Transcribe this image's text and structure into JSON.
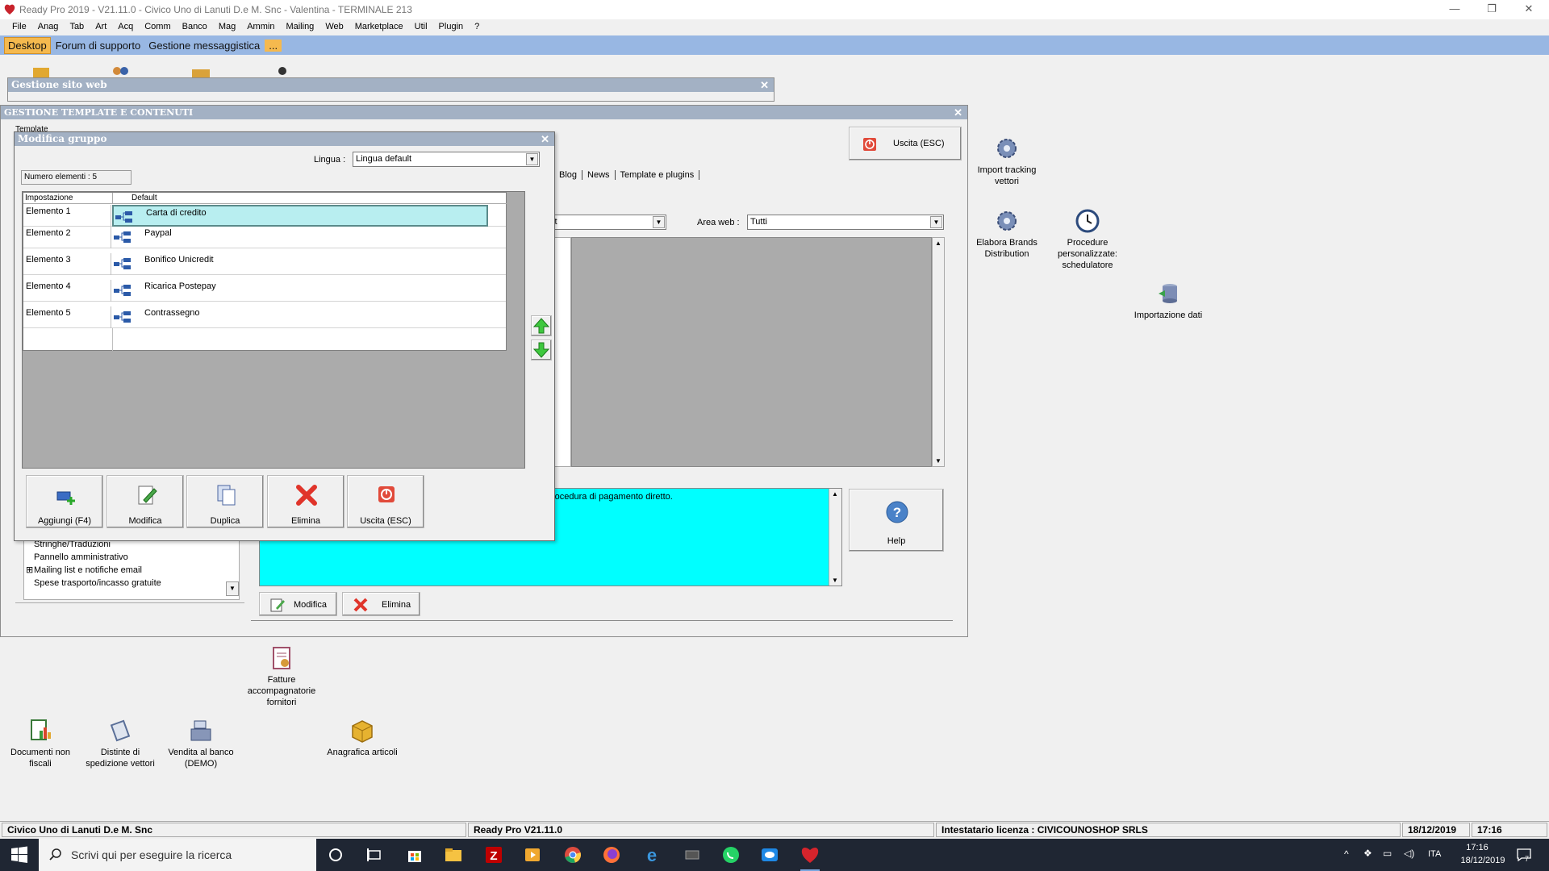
{
  "app_title": "Ready Pro 2019 - V21.11.0 - Civico Uno di Lanuti D.e M. Snc - Valentina - TERMINALE 213",
  "window_controls": {
    "minimize": "—",
    "restore": "❐",
    "close": "✕"
  },
  "menu": [
    "File",
    "Anag",
    "Tab",
    "Art",
    "Acq",
    "Comm",
    "Banco",
    "Mag",
    "Ammin",
    "Mailing",
    "Web",
    "Marketplace",
    "Util",
    "Plugin",
    "?"
  ],
  "tabs": [
    {
      "label": "Desktop",
      "active": true
    },
    {
      "label": "Forum di supporto",
      "active": false
    },
    {
      "label": "Gestione messaggistica",
      "active": false
    },
    {
      "label": "...",
      "active": false
    }
  ],
  "desktop_right_icons": [
    {
      "label": "Import tracking vettori",
      "icon": "gear-icon"
    },
    {
      "label": "Elabora Brands Distribution",
      "icon": "gear-icon"
    },
    {
      "label": "Procedure personalizzate: schedulatore",
      "icon": "clock-icon"
    },
    {
      "label": "Importazione dati",
      "icon": "database-icon"
    }
  ],
  "desktop_bottom_icons": [
    {
      "label": "Fatture accompagnatorie fornitori",
      "icon": "invoice-icon"
    },
    {
      "label": "Documenti non fiscali",
      "icon": "document-chart-icon"
    },
    {
      "label": "Distinte di spedizione vettori",
      "icon": "scroll-icon"
    },
    {
      "label": "Vendita al banco (DEMO)",
      "icon": "cash-register-icon"
    },
    {
      "label": "Anagrafica articoli",
      "icon": "box-icon"
    }
  ],
  "gestione_sito": {
    "title": "Gestione sito web"
  },
  "gestione_template": {
    "title": "GESTIONE TEMPLATE E CONTENUTI",
    "template_label": "Template",
    "exit_button": "Uscita (ESC)",
    "tabs": [
      "Blog",
      "News",
      "Template e plugins"
    ],
    "combo_partial": "lt",
    "area_web_label": "Area web :",
    "area_web_value": "Tutti",
    "description": "rocedura di pagamento diretto.",
    "help_button": "Help",
    "modifica_button": "Modifica",
    "elimina_button": "Elimina",
    "tree_items": [
      {
        "label": "Stringhe/Traduzioni",
        "expand": ""
      },
      {
        "label": "Pannello amministrativo",
        "expand": ""
      },
      {
        "label": "Mailing list e notifiche email",
        "expand": "⊞"
      },
      {
        "label": "Spese trasporto/incasso gratuite",
        "expand": ""
      }
    ]
  },
  "modifica_gruppo": {
    "title": "Modifica gruppo",
    "lingua_label": "Lingua :",
    "lingua_value": "Lingua default",
    "count": "Numero elementi : 5",
    "col_setting": "Impostazione",
    "col_default": "Default",
    "rows": [
      {
        "name": "Elemento 1",
        "value": "Carta di credito",
        "selected": true
      },
      {
        "name": "Elemento 2",
        "value": "Paypal",
        "selected": false
      },
      {
        "name": "Elemento 3",
        "value": "Bonifico Unicredit",
        "selected": false
      },
      {
        "name": "Elemento 4",
        "value": "Ricarica Postepay",
        "selected": false
      },
      {
        "name": "Elemento 5",
        "value": "Contrassegno",
        "selected": false
      }
    ],
    "buttons": {
      "add": "Aggiungi (F4)",
      "edit": "Modifica",
      "duplicate": "Duplica",
      "delete": "Elimina",
      "exit": "Uscita (ESC)"
    }
  },
  "status": {
    "company": "Civico Uno di Lanuti D.e M. Snc",
    "version": "Ready Pro V21.11.0",
    "license": "Intestatario licenza : CIVICOUNOSHOP SRLS",
    "date": "18/12/2019",
    "time": "17:16"
  },
  "taskbar": {
    "search_placeholder": "Scrivi qui per eseguire la ricerca",
    "lang": "ITA",
    "time": "17:16",
    "date": "18/12/2019",
    "notification_count": "7"
  }
}
